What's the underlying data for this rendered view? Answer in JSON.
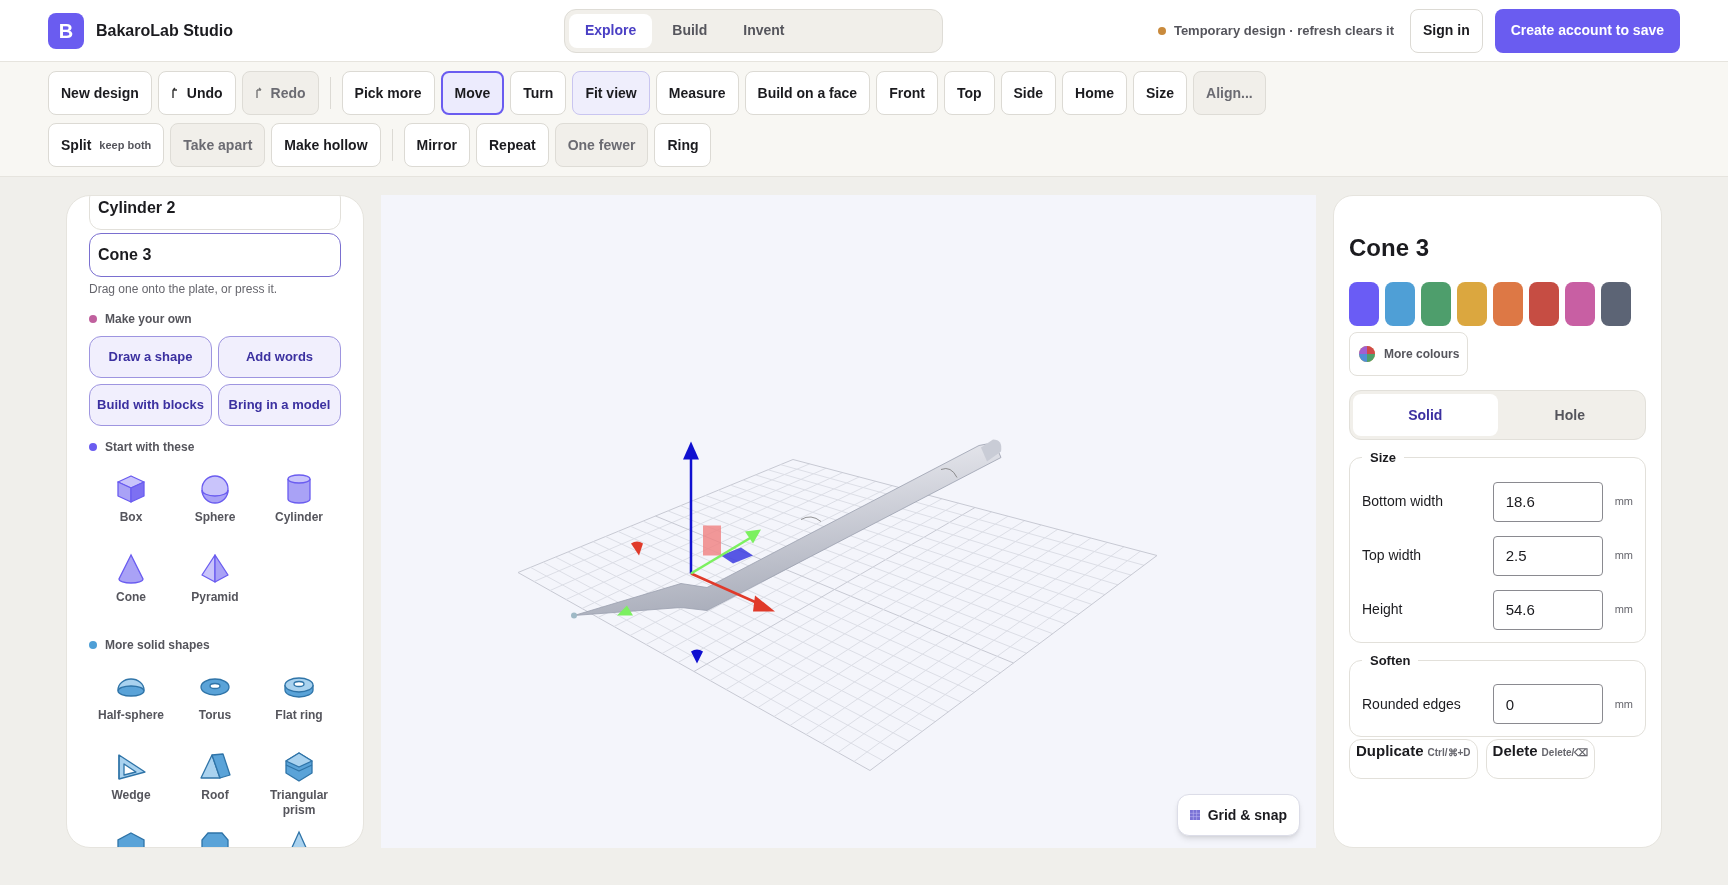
{
  "app": {
    "logo": "B",
    "name": "BakaroLab Studio"
  },
  "modes": [
    {
      "label": "Explore",
      "selected": true
    },
    {
      "label": "Build",
      "selected": false
    },
    {
      "label": "Invent",
      "selected": false
    }
  ],
  "notice": "Temporary design · refresh clears it",
  "sign_in": "Sign in",
  "create_account": "Create account to save",
  "toolbar": [
    [
      [
        {
          "label": "New design",
          "kind": "plain",
          "selected": false,
          "toggled": false,
          "disabled": false
        },
        {
          "label": "Undo",
          "kind": "undo",
          "selected": false,
          "toggled": false,
          "disabled": false
        },
        {
          "label": "Redo",
          "kind": "redo",
          "selected": false,
          "toggled": false,
          "disabled": true
        }
      ],
      [
        {
          "label": "Pick more",
          "kind": "plain",
          "selected": false,
          "toggled": false,
          "disabled": false
        },
        {
          "label": "Move",
          "kind": "plain",
          "selected": true,
          "toggled": false,
          "disabled": false
        },
        {
          "label": "Turn",
          "kind": "plain",
          "selected": false,
          "toggled": false,
          "disabled": false
        },
        {
          "label": "Fit view",
          "kind": "plain",
          "selected": false,
          "toggled": true,
          "disabled": false
        },
        {
          "label": "Measure",
          "kind": "plain",
          "selected": false,
          "toggled": false,
          "disabled": false
        },
        {
          "label": "Build on a face",
          "kind": "plain",
          "selected": false,
          "toggled": false,
          "disabled": false
        },
        {
          "label": "Front",
          "kind": "plain",
          "selected": false,
          "toggled": false,
          "disabled": false
        },
        {
          "label": "Top",
          "kind": "plain",
          "selected": false,
          "toggled": false,
          "disabled": false
        },
        {
          "label": "Side",
          "kind": "plain",
          "selected": false,
          "toggled": false,
          "disabled": false
        },
        {
          "label": "Home",
          "kind": "plain",
          "selected": false,
          "toggled": false,
          "disabled": false
        },
        {
          "label": "Size",
          "kind": "plain",
          "selected": false,
          "toggled": false,
          "disabled": false
        },
        {
          "label": "Align...",
          "kind": "plain",
          "selected": false,
          "toggled": false,
          "disabled": true
        }
      ]
    ],
    [
      [
        {
          "label": "Split",
          "hint": "keep both",
          "kind": "plain",
          "selected": false,
          "toggled": false,
          "disabled": false
        },
        {
          "label": "Take apart",
          "kind": "plain",
          "selected": false,
          "toggled": false,
          "disabled": true
        },
        {
          "label": "Make hollow",
          "kind": "plain",
          "selected": false,
          "toggled": false,
          "disabled": false
        }
      ],
      [
        {
          "label": "Mirror",
          "kind": "plain",
          "selected": false,
          "toggled": false,
          "disabled": false
        },
        {
          "label": "Repeat",
          "kind": "plain",
          "selected": false,
          "toggled": false,
          "disabled": false
        },
        {
          "label": "One fewer",
          "kind": "plain",
          "selected": false,
          "toggled": false,
          "disabled": true
        },
        {
          "label": "Ring",
          "kind": "plain",
          "selected": false,
          "toggled": false,
          "disabled": false
        }
      ]
    ]
  ],
  "parts": [
    {
      "label": "Cylinder 2",
      "selected": false
    },
    {
      "label": "Cone 3",
      "selected": true
    }
  ],
  "parts_hint": "Drag one onto the plate, or press it.",
  "sections": [
    {
      "title": "Make your own",
      "color": "#c0609e",
      "kind": "actions",
      "items": [
        "Draw a shape",
        "Add words",
        "Build with blocks",
        "Bring in a model"
      ]
    },
    {
      "title": "Start with these",
      "color": "#6a5cf0",
      "kind": "shapes",
      "items": [
        "Box",
        "Sphere",
        "Cylinder",
        "Cone",
        "Pyramid"
      ]
    },
    {
      "title": "More solid shapes",
      "color": "#4e9fd6",
      "kind": "shapes",
      "items": [
        "Half-sphere",
        "Torus",
        "Flat ring",
        "Wedge",
        "Roof",
        "Triangular prism"
      ]
    }
  ],
  "grid_button": "Grid & snap",
  "inspector": {
    "title": "Cone 3",
    "swatches": [
      {
        "color": "#6a5cf5"
      },
      {
        "color": "#4f9fd6"
      },
      {
        "color": "#4e9e6c"
      },
      {
        "color": "#dba73f"
      },
      {
        "color": "#dd7845"
      },
      {
        "color": "#c64d43"
      },
      {
        "color": "#c85fa3"
      },
      {
        "color": "#5c6475"
      }
    ],
    "more_colours": "More colours",
    "types": [
      {
        "label": "Solid",
        "selected": true
      },
      {
        "label": "Hole",
        "selected": false
      }
    ],
    "groups": [
      {
        "title": "Size",
        "fields": [
          {
            "label": "Bottom width",
            "value": "18.6",
            "unit": "mm"
          },
          {
            "label": "Top width",
            "value": "2.5",
            "unit": "mm"
          },
          {
            "label": "Height",
            "value": "54.6",
            "unit": "mm"
          }
        ]
      },
      {
        "title": "Soften",
        "fields": [
          {
            "label": "Rounded edges",
            "value": "0",
            "unit": "mm"
          }
        ]
      }
    ],
    "actions": [
      {
        "label": "Duplicate",
        "shortcut": "Ctrl/⌘+D"
      },
      {
        "label": "Delete",
        "shortcut": "Delete/⌫"
      }
    ]
  }
}
